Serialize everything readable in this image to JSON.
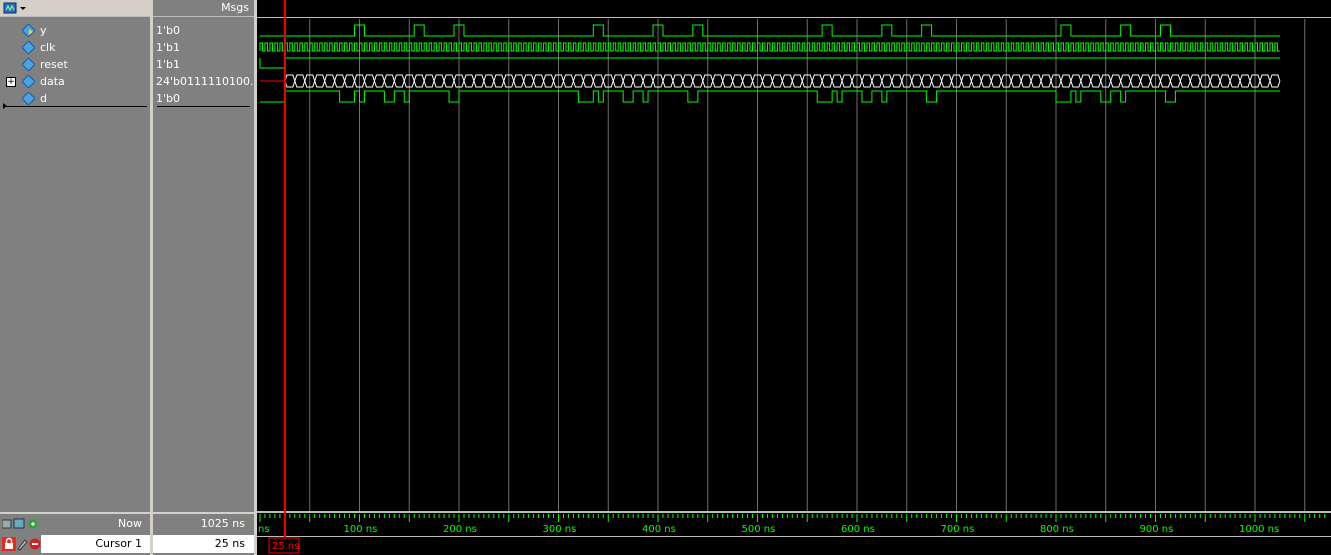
{
  "header": {
    "values_title": "Msgs"
  },
  "signals": [
    {
      "name": "y",
      "value": "1'b0"
    },
    {
      "name": "clk",
      "value": "1'b1"
    },
    {
      "name": "reset",
      "value": "1'b1"
    },
    {
      "name": "data",
      "value": "24'b0111110100...",
      "expandable": true
    },
    {
      "name": "d",
      "value": "1'b0"
    }
  ],
  "status": {
    "now_label": "Now",
    "now_value": "1025 ns",
    "cursor_label": "Cursor 1",
    "cursor_value": "25 ns",
    "cursor_tag": "25 ns"
  },
  "timeline": {
    "start_label": "ns",
    "ticks": [
      "100 ns",
      "200 ns",
      "300 ns",
      "400 ns",
      "500 ns",
      "600 ns",
      "700 ns",
      "800 ns",
      "900 ns",
      "1000 ns"
    ]
  },
  "colors": {
    "wave": "#00ff00",
    "cursor": "#ff0000",
    "grid": "#6e6e6e",
    "bus": "#ffffff"
  }
}
